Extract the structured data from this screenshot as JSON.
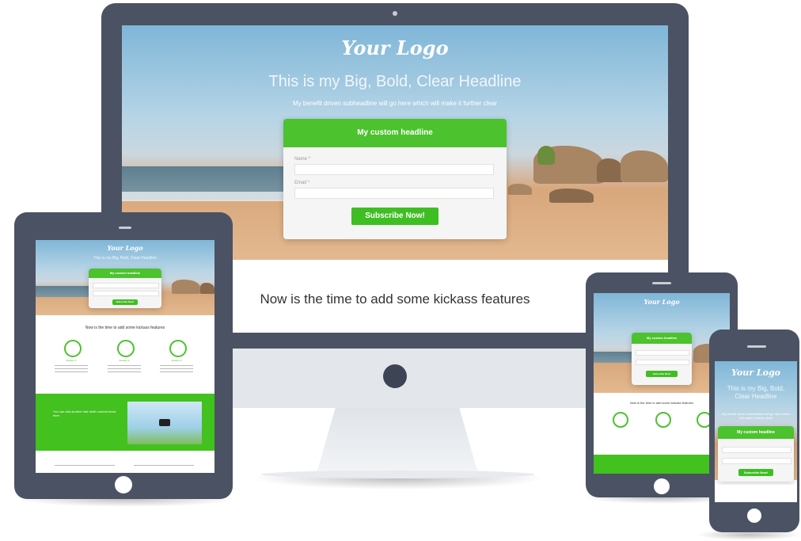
{
  "desktop": {
    "logo": "Your Logo",
    "headline": "This is my Big, Bold, Clear Headline",
    "subheadline": "My benefit driven subheadline will go here which will make it further clear",
    "form": {
      "headline": "My custom headline",
      "name_label": "Name *",
      "email_label": "Email *",
      "button": "Subscribe Now!"
    },
    "features_heading": "Now is the time to add some kickass features"
  },
  "tablet": {
    "logo": "Your Logo",
    "headline": "This is my Big, Bold, Clear Headline",
    "form_headline": "My custom headline",
    "button": "Subscribe Now!",
    "features_heading": "Now is the time to add some kickass features",
    "features": [
      "Feature 1",
      "Feature 2",
      "Feature 3"
    ],
    "green_text": "You can add another half width content block here"
  },
  "phone_small": {
    "logo": "Your Logo",
    "form_headline": "My custom headline",
    "button": "Subscribe Now!",
    "features_heading": "Now is the time to add some kickass features"
  },
  "phone": {
    "logo": "Your Logo",
    "headline": "This is my Big, Bold, Clear Headline",
    "subheadline": "My benefit driven subheadline will go here which will make it further clear",
    "form_headline": "My custom headline",
    "button": "Subscribe Now!"
  },
  "colors": {
    "accent": "#42c11f",
    "device": "#4b5263"
  }
}
